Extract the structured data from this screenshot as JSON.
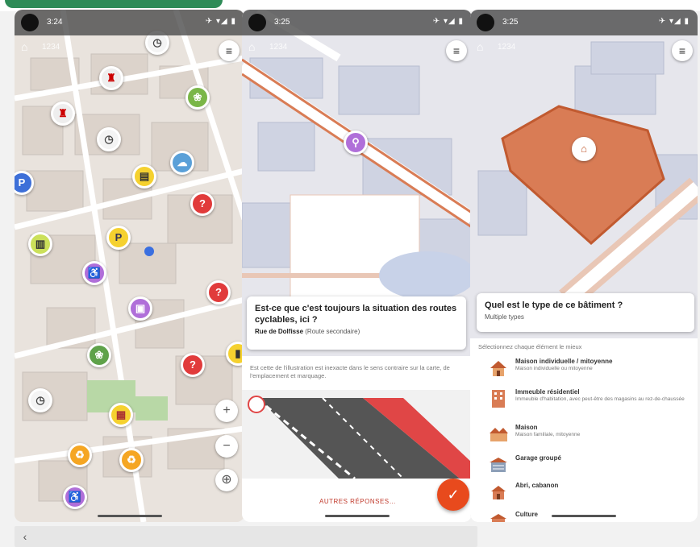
{
  "phones": [
    {
      "time": "3:24",
      "status_icons": "✈ ▾◢ ▮",
      "counter": "1234",
      "menu_icon": "≡"
    },
    {
      "time": "3:25",
      "status_icons": "✈ ▾◢ ▮",
      "counter": "1234",
      "menu_icon": "≡",
      "question": "Est-ce que c'est toujours la situation des routes cyclables, ici ?",
      "street_name": "Rue de Dolfisse",
      "street_hint": "(Route secondaire)",
      "hint_text": "Est cette de l'illustration est inexacte dans le sens contraire sur la carte, de l'emplacement et marquage.",
      "other_answers": "AUTRES RÉPONSES…",
      "ok_icon": "✓"
    },
    {
      "time": "3:25",
      "status_icons": "✈ ▾◢ ▮",
      "counter": "1234",
      "menu_icon": "≡",
      "question": "Quel est le type de ce bâtiment ?",
      "subtitle": "Multiple types",
      "options_header": "Sélectionnez chaque élément le mieux",
      "options": [
        {
          "title": "Maison individuelle / mitoyenne",
          "desc": "Maison individuelle ou mitoyenne",
          "icon": "house-icon"
        },
        {
          "title": "Immeuble résidentiel",
          "desc": "Immeuble d'habitation, avec peut-être des magasins au rez-de-chaussée",
          "icon": "apartments-icon"
        },
        {
          "title": "Maison",
          "desc": "Maison familiale, mitoyenne",
          "icon": "detached-house-icon"
        },
        {
          "title": "Garage groupé",
          "desc": "",
          "icon": "garage-icon"
        },
        {
          "title": "Abri, cabanon",
          "desc": "",
          "icon": "shed-icon"
        },
        {
          "title": "Culture",
          "desc": "",
          "icon": "culture-icon"
        }
      ]
    }
  ],
  "colors": {
    "accent": "#e84a1d",
    "building_fill": "#d97c55",
    "map_bg": "#e9e3dd"
  }
}
